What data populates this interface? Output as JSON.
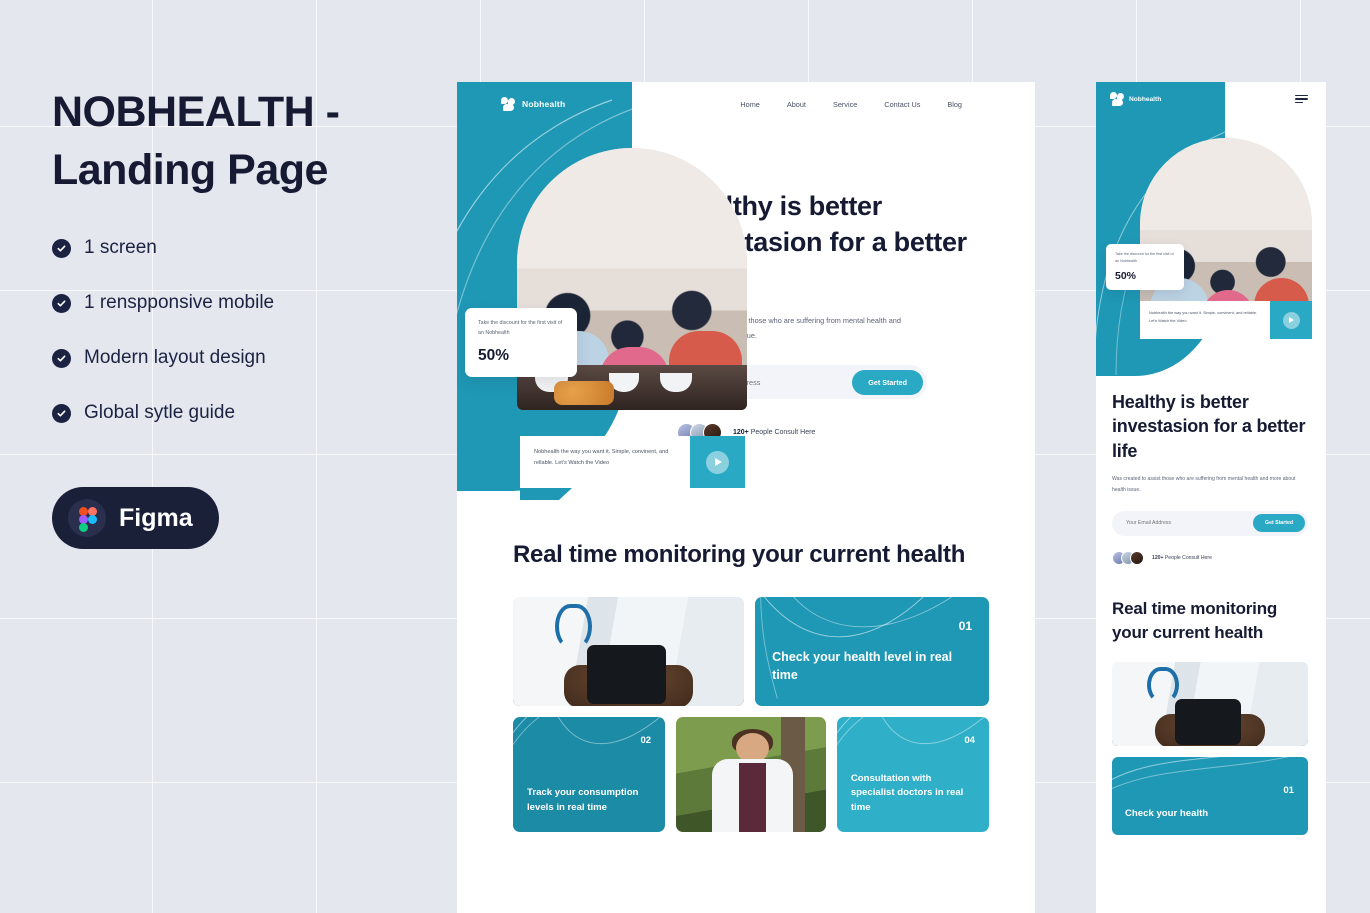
{
  "left_panel": {
    "title": "NOBHEALTH - Landing Page",
    "features": [
      {
        "label": "1 screen"
      },
      {
        "label": "1 renspponsive mobile"
      },
      {
        "label": "Modern layout design"
      },
      {
        "label": "Global sytle guide"
      }
    ],
    "badge": {
      "label": "Figma",
      "icon": "figma-logo"
    }
  },
  "brand": {
    "name": "Nobhealth",
    "accent": "#1f98b5",
    "accent_light": "#2fb0c8",
    "accent_dark": "#1b8ba6",
    "ink": "#161b33",
    "page_bg": "#e4e7ee"
  },
  "desktop": {
    "nav": [
      {
        "label": "Home"
      },
      {
        "label": "About"
      },
      {
        "label": "Service"
      },
      {
        "label": "Contact Us"
      },
      {
        "label": "Blog"
      }
    ],
    "hero": {
      "heading": "Healthy is better investasion for a better life",
      "subtext": "Was created to assist those who are suffering from mental health and more about health issue.",
      "email_placeholder": "Your Email Address",
      "email_value": "",
      "cta_label": "Get Started",
      "consult_count": "120+",
      "consult_text": " People Consult Here",
      "discount": {
        "text": "Take the discount for the first visit of an Nobhealth",
        "value": "50%"
      },
      "video": {
        "caption": "Nobhealth the way you want it. Simple, convinent, and rellable. Let's Watch the Video",
        "icon": "play-icon"
      }
    },
    "monitoring": {
      "heading": "Real time monitoring your current health",
      "cards": [
        {
          "number": "01",
          "title": "Check your health level in real time",
          "type": "teal"
        },
        {
          "number": "02",
          "title": "Track your consumption levels in real time",
          "type": "teal-dark"
        },
        {
          "number": "04",
          "title": "Consultation with specialist doctors in real time",
          "type": "teal-light"
        }
      ],
      "photo_alt_doctor_phone": "doctor-holding-phone",
      "photo_alt_doctor_lady": "female-doctor-portrait"
    }
  },
  "mobile": {
    "menu_icon": "hamburger-icon",
    "hero": {
      "heading": "Healthy is better investasion for a better life",
      "subtext": "Was created to assist those who are suffering from mental health and more about health issue.",
      "email_placeholder": "Your Email Address",
      "email_value": "",
      "cta_label": "Get Started",
      "consult_count": "120+",
      "consult_text": " People Consult Here",
      "discount": {
        "text": "Take the discount for the first visit of an Nobhealth",
        "value": "50%"
      },
      "video": {
        "caption": "Nobhealth the way you want it. Simple, convinent, and rellable. Let's Watch the Video"
      }
    },
    "monitoring": {
      "heading": "Real time monitoring your current health",
      "card": {
        "number": "01",
        "title": "Check your health"
      }
    }
  }
}
